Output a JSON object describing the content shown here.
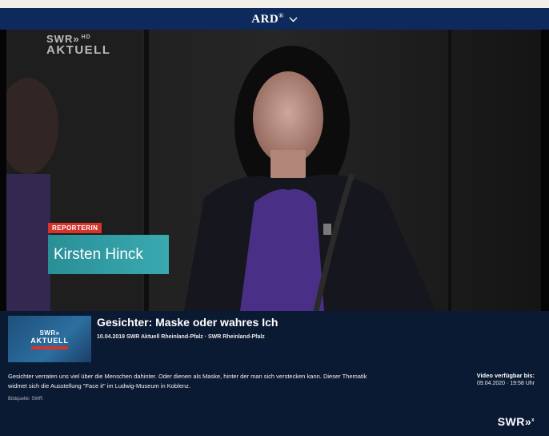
{
  "header": {
    "brand": "ARD",
    "brand_mark": "®",
    "menu_icon": "chevron-down-icon"
  },
  "video": {
    "channel_logo_line1": "SWR»",
    "channel_logo_hd": "HD",
    "channel_logo_line2": "AKTUELL",
    "role_tag": "REPORTERIN",
    "person_name": "Kirsten Hinck"
  },
  "info": {
    "thumb_line1": "SWR»",
    "thumb_line2": "AKTUELL",
    "title": "Gesichter: Maske oder wahres Ich",
    "meta": "10.04.2019 SWR Aktuell Rheinland-Pfalz · SWR Rheinland-Pfalz",
    "description": "Gesichter verraten uns viel über die Menschen dahinter. Oder dienen als Maske, hinter der man sich verstecken kann. Dieser Thematik widmet sich die Ausstellung \"Face it\" im Ludwig-Museum in Koblenz.",
    "credit": "Bildquelle: SWR",
    "availability_label": "Video verfügbar bis:",
    "availability_date": "09.04.2020 · 19:58 Uhr",
    "footer_logo": "SWR»",
    "footer_logo_sup": "x"
  },
  "colors": {
    "header_bg": "#0e2a5c",
    "panel_bg": "#0b1a33",
    "role_tag_red": "#d4342c",
    "name_box_teal": "#3aa9b0"
  }
}
